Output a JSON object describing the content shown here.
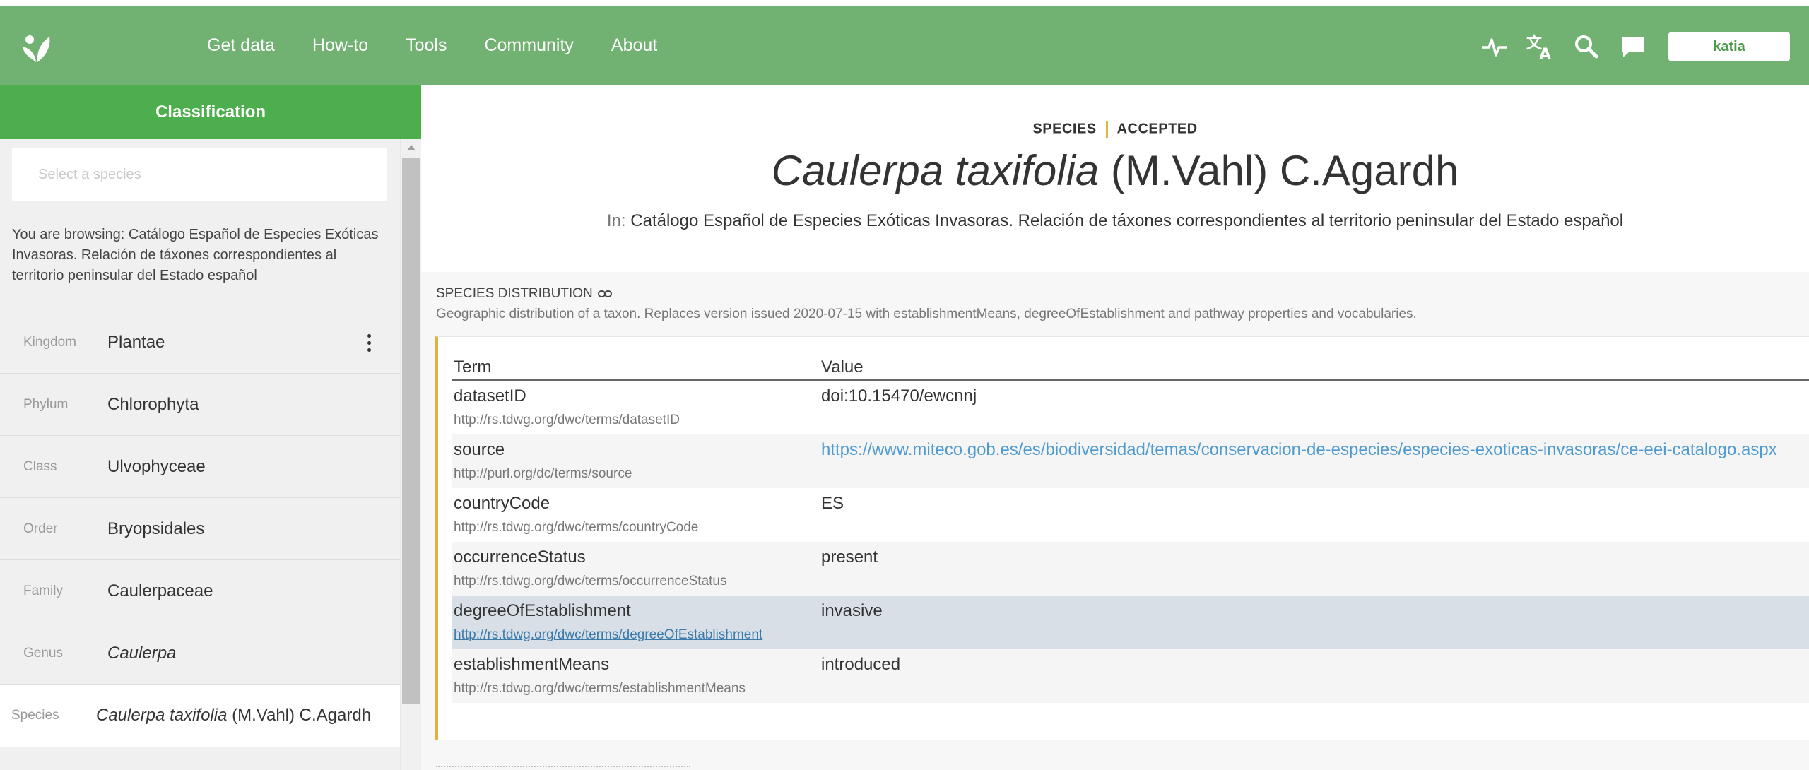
{
  "nav": {
    "links": [
      "Get data",
      "How-to",
      "Tools",
      "Community",
      "About"
    ],
    "icons": [
      "activity-icon",
      "translate-icon",
      "search-icon",
      "feedback-icon"
    ],
    "user": "katia"
  },
  "sidebar": {
    "header": "Classification",
    "search_placeholder": "Select a species",
    "browsing_text": "You are browsing: Catálogo Español de Especies Exóticas Invasoras. Relación de táxones correspondientes al territorio peninsular del Estado español",
    "ranks": [
      {
        "label": "Kingdom",
        "value": "Plantae"
      },
      {
        "label": "Phylum",
        "value": "Chlorophyta"
      },
      {
        "label": "Class",
        "value": "Ulvophyceae"
      },
      {
        "label": "Order",
        "value": "Bryopsidales"
      },
      {
        "label": "Family",
        "value": "Caulerpaceae"
      },
      {
        "label": "Genus",
        "value": "Caulerpa"
      }
    ],
    "species": {
      "label": "Species",
      "name": "Caulerpa taxifolia",
      "author": " (M.Vahl) C.Agardh"
    }
  },
  "main": {
    "rank": "SPECIES",
    "status": "ACCEPTED",
    "title_name": "Caulerpa taxifolia",
    "title_author": " (M.Vahl) C.Agardh",
    "in_label": "In:",
    "in_value": " Catálogo Español de Especies Exóticas Invasoras. Relación de táxones correspondientes al territorio peninsular del Estado español",
    "section_title": "SPECIES DISTRIBUTION",
    "section_desc": "Geographic distribution of a taxon. Replaces version issued 2020-07-15 with establishmentMeans, degreeOfEstablishment and pathway properties and vocabularies.",
    "columns": [
      "Term",
      "Value"
    ],
    "rows": [
      {
        "term": "datasetID",
        "uri": "http://rs.tdwg.org/dwc/terms/datasetID",
        "value": "doi:10.15470/ewcnnj"
      },
      {
        "term": "source",
        "uri": "http://purl.org/dc/terms/source",
        "value": "https://www.miteco.gob.es/es/biodiversidad/temas/conservacion-de-especies/especies-exoticas-invasoras/ce-eei-catalogo.aspx"
      },
      {
        "term": "countryCode",
        "uri": "http://rs.tdwg.org/dwc/terms/countryCode",
        "value": "ES"
      },
      {
        "term": "occurrenceStatus",
        "uri": "http://rs.tdwg.org/dwc/terms/occurrenceStatus",
        "value": "present"
      },
      {
        "term": "degreeOfEstablishment",
        "uri": "http://rs.tdwg.org/dwc/terms/degreeOfEstablishment",
        "value": "invasive"
      },
      {
        "term": "establishmentMeans",
        "uri": "http://rs.tdwg.org/dwc/terms/establishmentMeans",
        "value": "introduced"
      }
    ]
  }
}
